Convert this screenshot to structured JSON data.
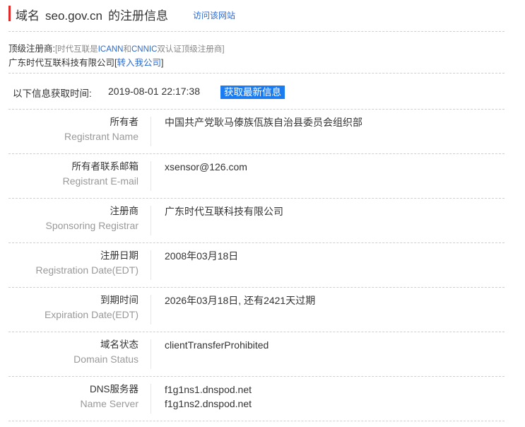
{
  "header": {
    "prefix": "域名",
    "domain": "seo.gov.cn",
    "suffix": "的注册信息",
    "visit_link": "访问该网站"
  },
  "registrar": {
    "label": "顶级注册商:",
    "note_pre": "[时代互联是",
    "note_icann": "ICANN",
    "note_and": "和",
    "note_cnnic": "CNNIC",
    "note_post": "双认证顶级注册商]",
    "company": "广东时代互联科技有限公司",
    "transfer_link": "转入我公司",
    "bracket_open": "[",
    "bracket_close": "]"
  },
  "fetch": {
    "label": "以下信息获取时间:",
    "time": "2019-08-01 22:17:38",
    "button": "获取最新信息"
  },
  "rows": [
    {
      "zh": "所有者",
      "en": "Registrant Name",
      "values": [
        "中国共产党耿马傣族佤族自治县委员会组织部"
      ]
    },
    {
      "zh": "所有者联系邮箱",
      "en": "Registrant E-mail",
      "values": [
        "xsensor@126.com"
      ]
    },
    {
      "zh": "注册商",
      "en": "Sponsoring Registrar",
      "values": [
        "广东时代互联科技有限公司"
      ]
    },
    {
      "zh": "注册日期",
      "en": "Registration Date(EDT)",
      "values": [
        "2008年03月18日"
      ]
    },
    {
      "zh": "到期时间",
      "en": "Expiration Date(EDT)",
      "values": [
        "2026年03月18日, 还有2421天过期"
      ]
    },
    {
      "zh": "域名状态",
      "en": "Domain Status",
      "values": [
        "clientTransferProhibited"
      ]
    },
    {
      "zh": "DNS服务器",
      "en": "Name Server",
      "values": [
        "f1g1ns1.dnspod.net",
        "f1g1ns2.dnspod.net"
      ]
    }
  ],
  "colors": {
    "accent_red": "#e02a2a",
    "link_blue": "#2a6ad3",
    "button_blue": "#1a7cf0"
  }
}
